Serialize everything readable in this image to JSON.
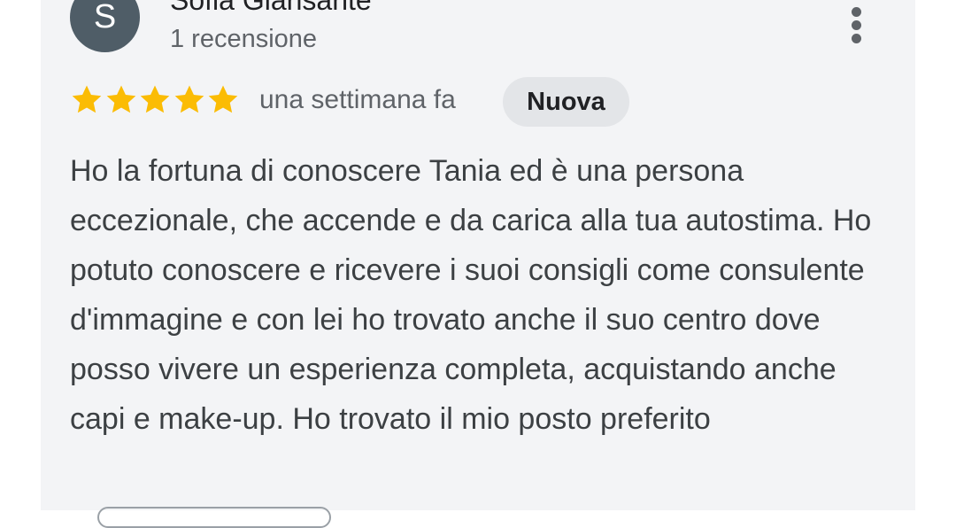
{
  "review": {
    "avatar_letter": "S",
    "author_name": "Sofia Giansante",
    "review_count": "1 recensione",
    "rating": 5,
    "rating_max": 5,
    "time_ago": "una settimana fa",
    "badge": "Nuova",
    "text": "Ho la fortuna di conoscere Tania ed è una persona eccezionale, che accende e da carica alla tua autostima. Ho potuto conoscere e ricevere i suoi consigli come consulente d'immagine e con lei ho trovato anche il suo centro dove posso vivere un esperienza completa, acquistando anche capi e make-up. Ho trovato il mio posto preferito"
  },
  "colors": {
    "star": "#fbbc04",
    "avatar_bg": "#4f5d67",
    "card_bg": "#f3f4f6",
    "badge_bg": "#e3e5e8"
  },
  "icons": {
    "more_menu": "more-vert-icon",
    "star": "star-icon"
  }
}
